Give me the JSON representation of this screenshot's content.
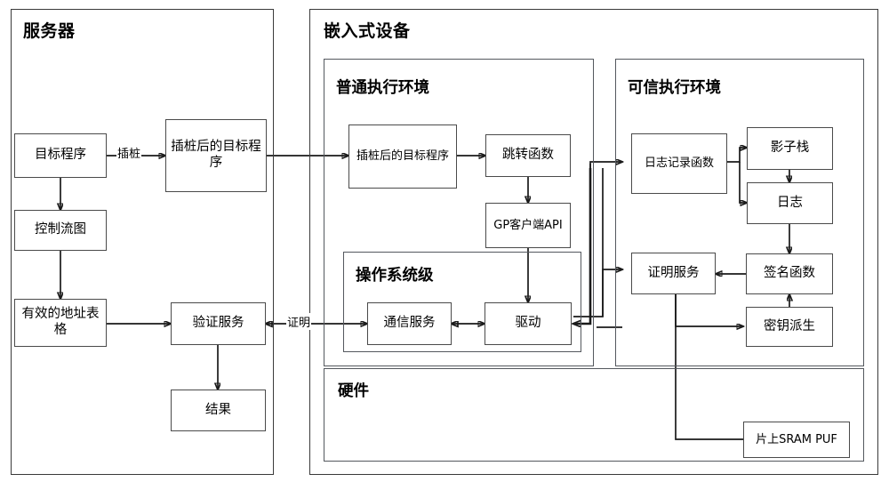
{
  "diagram": {
    "title_hidden": "",
    "panels": {
      "server": {
        "label": "服务器"
      },
      "embedded_device": {
        "label": "嵌入式设备"
      },
      "normal_world": {
        "label": "普通执行环境"
      },
      "os_level": {
        "label": "操作系统级"
      },
      "trusted_world": {
        "label": "可信执行环境"
      },
      "hardware": {
        "label": "硬件"
      }
    },
    "nodes": {
      "target_program": {
        "label": "目标程序"
      },
      "instrumented_program_server": {
        "label": "插桩后的目标程序"
      },
      "control_flow_graph": {
        "label": "控制流图"
      },
      "valid_address_table": {
        "label": "有效的地址表格"
      },
      "verification_service": {
        "label": "验证服务"
      },
      "result": {
        "label": "结果"
      },
      "instrumented_program_device": {
        "label": "插桩后的目标程序"
      },
      "jump_function": {
        "label": "跳转函数"
      },
      "gp_client_api": {
        "label": "GP客户端API"
      },
      "communication_service": {
        "label": "通信服务"
      },
      "driver": {
        "label": "驱动"
      },
      "log_record_function": {
        "label": "日志记录函数"
      },
      "shadow_stack": {
        "label": "影子栈"
      },
      "log": {
        "label": "日志"
      },
      "attestation_service": {
        "label": "证明服务"
      },
      "signature_function": {
        "label": "签名函数"
      },
      "key_derivation": {
        "label": "密钥派生"
      },
      "sram_puf": {
        "label": "片上SRAM PUF"
      }
    },
    "edge_labels": {
      "instrumentation": "插桩",
      "attestation": "证明"
    },
    "colors": {
      "panel_border": "#3a3a3a",
      "subpanel_border": "#54585e",
      "node_border": "#4a4a4a",
      "wire": "#1a1a1a",
      "background": "#ffffff",
      "text": "#000000"
    }
  }
}
